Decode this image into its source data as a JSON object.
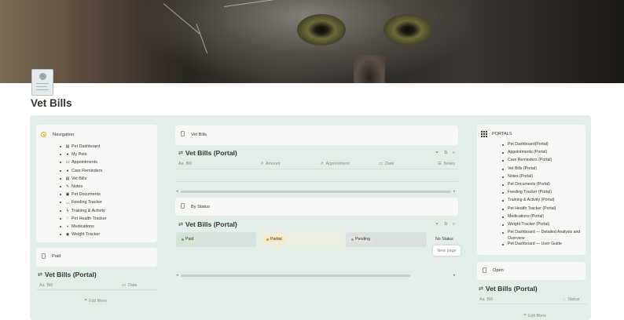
{
  "page": {
    "title": "Vet Bills"
  },
  "navigation": {
    "header": "Navigation",
    "items": [
      {
        "label": "Pet Dashboard",
        "icon": "document-icon",
        "glyph": "▤"
      },
      {
        "label": "My Pets",
        "icon": "paw-icon",
        "glyph": "●"
      },
      {
        "label": "Appointments",
        "icon": "calendar-icon",
        "glyph": "▭"
      },
      {
        "label": "Care Reminders",
        "icon": "bell-icon",
        "glyph": "♦"
      },
      {
        "label": "Vet Bills",
        "icon": "receipt-icon",
        "glyph": "▤"
      },
      {
        "label": "Notes",
        "icon": "note-icon",
        "glyph": "✎"
      },
      {
        "label": "Pet Documents",
        "icon": "folder-icon",
        "glyph": "▣"
      },
      {
        "label": "Feeding Tracker",
        "icon": "bowl-icon",
        "glyph": "◡"
      },
      {
        "label": "Training & Activity",
        "icon": "activity-icon",
        "glyph": "ϟ"
      },
      {
        "label": "Pet Health Tracker",
        "icon": "health-icon",
        "glyph": "♡"
      },
      {
        "label": "Medications",
        "icon": "pill-icon",
        "glyph": "◖"
      },
      {
        "label": "Weight Tracker",
        "icon": "scale-icon",
        "glyph": "◉"
      }
    ]
  },
  "paid": {
    "label": "Paid",
    "db_title": "Vet Bills (Portal)",
    "columns": [
      "Bill",
      "Date"
    ],
    "filter_label": "Edit filters"
  },
  "center": {
    "header": "Vet Bills",
    "db_title": "Vet Bills (Portal)",
    "columns": [
      "Bill",
      "Amount",
      "Appointment",
      "Date",
      "Notes"
    ],
    "status_header": "By Status",
    "board_title": "Vet Bills (Portal)",
    "groups": [
      "Paid",
      "Partial",
      "Pending",
      "No Status"
    ],
    "new_page": "New page"
  },
  "portals": {
    "header": "PORTALS",
    "items": [
      "Pet Dashboard(Portal)",
      "Appointments (Portal)",
      "Care Reminders (Portal)",
      "Vet Bills (Portal)",
      "Notes (Portal)",
      "Pet Documents (Portal)",
      "Feeding Tracker (Portal)",
      "Training & Activity (Portal)",
      "Pet Health Tracker (Portal)",
      "Medications (Portal)",
      "Weight Tracker (Portal)",
      "Pet Dashboard — Detailed Analysis and Overview",
      "Pet Dashboard — User Guide"
    ]
  },
  "open": {
    "label": "Open",
    "db_title": "Vet Bills (Portal)",
    "columns": [
      "Bill",
      "Status"
    ],
    "filter_label": "Edit filters"
  },
  "colors": {
    "board_bg": "#e3eee8",
    "paid_pill": "#dbeddb",
    "partial_pill": "#fbf3db",
    "pending_pill": "#e3e2e0"
  }
}
